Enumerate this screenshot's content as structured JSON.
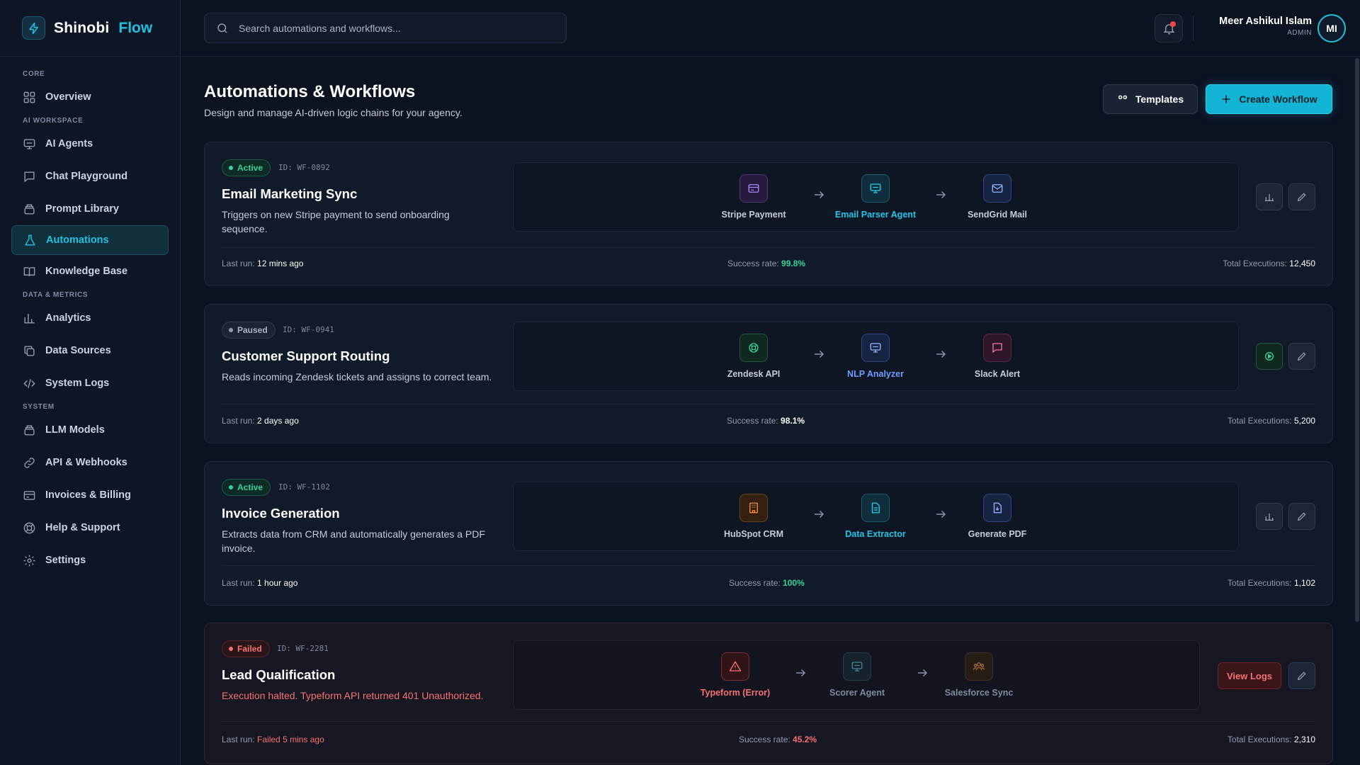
{
  "brand": {
    "name": "Shinobi",
    "accent": "Flow"
  },
  "search": {
    "placeholder": "Search automations and workflows..."
  },
  "user": {
    "name": "Meer Ashikul Islam",
    "role": "ADMIN",
    "initials": "MI"
  },
  "sidebar": {
    "sections": [
      {
        "label": "CORE",
        "items": [
          {
            "label": "Overview",
            "icon": "grid-icon"
          }
        ]
      },
      {
        "label": "AI WORKSPACE",
        "items": [
          {
            "label": "AI Agents",
            "icon": "monitor-icon"
          },
          {
            "label": "Chat Playground",
            "icon": "chat-icon"
          },
          {
            "label": "Prompt Library",
            "icon": "stack-icon"
          },
          {
            "label": "Automations",
            "icon": "flask-icon",
            "active": true
          },
          {
            "label": "Knowledge Base",
            "icon": "book-icon"
          }
        ]
      },
      {
        "label": "DATA & METRICS",
        "items": [
          {
            "label": "Analytics",
            "icon": "bar-chart-icon"
          },
          {
            "label": "Data Sources",
            "icon": "copy-icon"
          },
          {
            "label": "System Logs",
            "icon": "code-icon"
          }
        ]
      },
      {
        "label": "SYSTEM",
        "items": [
          {
            "label": "LLM Models",
            "icon": "stack-icon"
          },
          {
            "label": "API & Webhooks",
            "icon": "link-icon"
          },
          {
            "label": "Invoices & Billing",
            "icon": "credit-card-icon"
          },
          {
            "label": "Help & Support",
            "icon": "lifebuoy-icon"
          },
          {
            "label": "Settings",
            "icon": "gear-icon"
          }
        ]
      }
    ]
  },
  "page": {
    "title": "Automations & Workflows",
    "subtitle": "Design and manage AI-driven logic chains for your agency.",
    "templates_label": "Templates",
    "create_label": "Create Workflow"
  },
  "workflows": [
    {
      "status": "Active",
      "id": "ID: WF-0892",
      "title": "Email Marketing Sync",
      "description": "Triggers on new Stripe payment to send onboarding sequence.",
      "nodes": [
        {
          "label": "Stripe Payment",
          "icon": "card-icon",
          "color": "purple"
        },
        {
          "label": "Email Parser Agent",
          "icon": "monitor-icon",
          "color": "cyan"
        },
        {
          "label": "SendGrid Mail",
          "icon": "mail-icon",
          "color": "blue"
        }
      ],
      "last_run_label": "Last run:",
      "last_run": "12 mins ago",
      "success_label": "Success rate:",
      "success_rate": "99.8%",
      "executions_label": "Total Executions:",
      "executions": "12,450"
    },
    {
      "status": "Paused",
      "id": "ID: WF-0941",
      "title": "Customer Support Routing",
      "description": "Reads incoming Zendesk tickets and assigns to correct team.",
      "nodes": [
        {
          "label": "Zendesk API",
          "icon": "lifebuoy-icon",
          "color": "green"
        },
        {
          "label": "NLP Analyzer",
          "icon": "monitor-icon",
          "color": "blue"
        },
        {
          "label": "Slack Alert",
          "icon": "chat-icon",
          "color": "pink"
        }
      ],
      "last_run_label": "Last run:",
      "last_run": "2 days ago",
      "success_label": "Success rate:",
      "success_rate": "98.1%",
      "executions_label": "Total Executions:",
      "executions": "5,200"
    },
    {
      "status": "Active",
      "id": "ID: WF-1102",
      "title": "Invoice Generation",
      "description": "Extracts data from CRM and automatically generates a PDF invoice.",
      "nodes": [
        {
          "label": "HubSpot CRM",
          "icon": "building-icon",
          "color": "orange"
        },
        {
          "label": "Data Extractor",
          "icon": "document-icon",
          "color": "cyan"
        },
        {
          "label": "Generate PDF",
          "icon": "file-download-icon",
          "color": "blue"
        }
      ],
      "last_run_label": "Last run:",
      "last_run": "1 hour ago",
      "success_label": "Success rate:",
      "success_rate": "100%",
      "executions_label": "Total Executions:",
      "executions": "1,102"
    },
    {
      "status": "Failed",
      "id": "ID: WF-2281",
      "title": "Lead Qualification",
      "description": "Execution halted. Typeform API returned 401 Unauthorized.",
      "nodes": [
        {
          "label": "Typeform (Error)",
          "icon": "warning-icon",
          "color": "red"
        },
        {
          "label": "Scorer Agent",
          "icon": "monitor-icon",
          "color": "muted-cyan"
        },
        {
          "label": "Salesforce Sync",
          "icon": "users-icon",
          "color": "muted-orange"
        }
      ],
      "view_logs_label": "View Logs",
      "last_run_label": "Last run:",
      "last_run": "Failed 5 mins ago",
      "success_label": "Success rate:",
      "success_rate": "45.2%",
      "executions_label": "Total Executions:",
      "executions": "2,310"
    }
  ],
  "colors": {
    "accent": "#1fc0e0",
    "success": "#34d399",
    "danger": "#f87171",
    "background": "#0b1220"
  }
}
